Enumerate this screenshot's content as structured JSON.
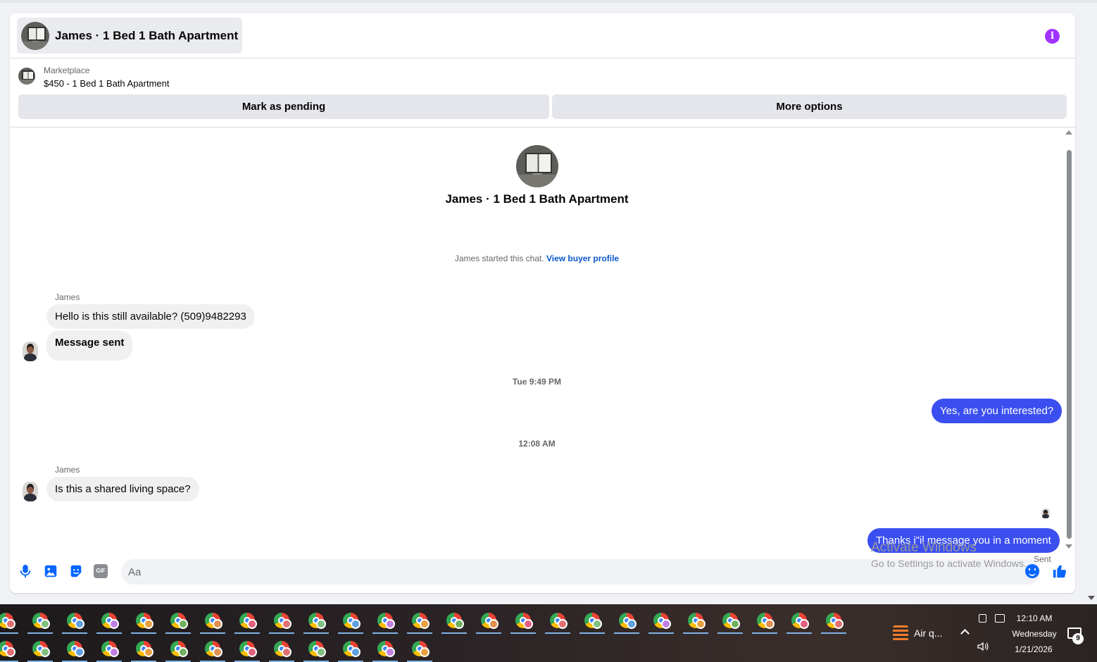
{
  "conversation": {
    "title": "James · 1 Bed 1 Bath Apartment",
    "info_icon": "info-icon"
  },
  "listing": {
    "source_label": "Marketplace",
    "item": "$450 - 1 Bed 1 Bath Apartment",
    "mark_pending_label": "Mark as pending",
    "more_options_label": "More options"
  },
  "thread": {
    "title": "James · 1 Bed 1 Bath Apartment",
    "started_text": "James started this chat.",
    "view_profile_link": "View buyer profile",
    "messages": [
      {
        "sender": "James",
        "text": "Hello is this still available? (509)9482293",
        "direction": "in"
      },
      {
        "text": "Message sent",
        "direction": "in"
      },
      {
        "timestamp": "Tue 9:49 PM"
      },
      {
        "text": "Yes, are you interested?",
        "direction": "out"
      },
      {
        "timestamp": "12:08 AM"
      },
      {
        "sender": "James",
        "text": "Is this a shared living space?",
        "direction": "in"
      },
      {
        "text": "Thanks i\"il message you in a moment",
        "direction": "out",
        "status": "Sent"
      }
    ]
  },
  "composer": {
    "placeholder": "Aa",
    "icons": [
      "microphone-icon",
      "photo-icon",
      "sticker-icon",
      "gif-icon",
      "emoji-icon",
      "thumbs-up-icon"
    ],
    "gif_label": "GIF"
  },
  "watermark": {
    "line1": "Activate Windows",
    "line2": "Go to Settings to activate Windows."
  },
  "taskbar": {
    "weather_label": "Air q...",
    "time": "12:10 AM",
    "day": "Wednesday",
    "date": "1/21/2026",
    "notification_count": "9"
  },
  "colors": {
    "outgoing_bubble": "#3b4ff0",
    "incoming_bubble": "#f0f0f0",
    "accent_icon": "#0866ff",
    "info_icon": "#a033ff"
  }
}
